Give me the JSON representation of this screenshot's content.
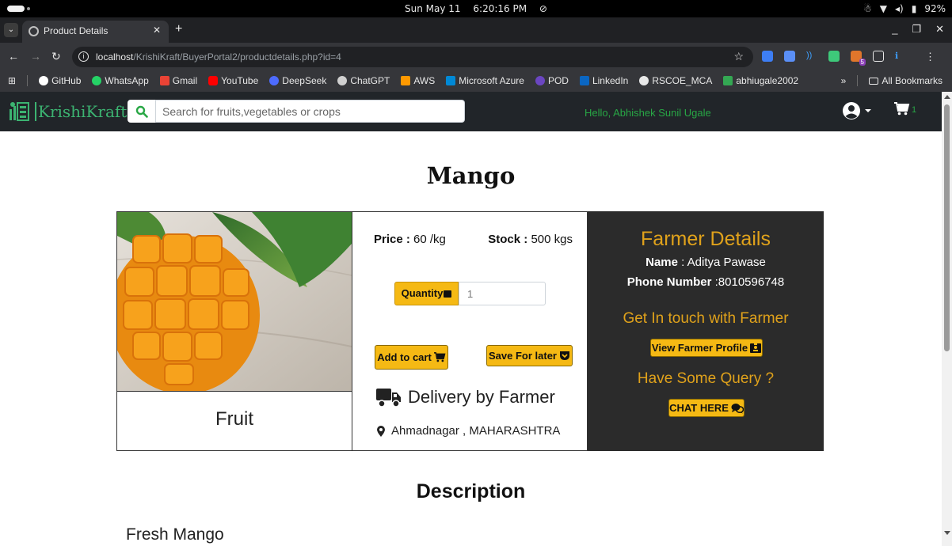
{
  "os": {
    "clock_date": "Sun May 11",
    "clock_time": "6:20:16 PM",
    "battery": "92%"
  },
  "browser": {
    "tab_title": "Product Details",
    "url_host": "localhost",
    "url_path": "/KrishiKraft/BuyerPortal2/productdetails.php?id=4",
    "extension_badge": "5",
    "bookmarks": [
      "GitHub",
      "WhatsApp",
      "Gmail",
      "YouTube",
      "DeepSeek",
      "ChatGPT",
      "AWS",
      "Microsoft Azure",
      "POD",
      "LinkedIn",
      "RSCOE_MCA",
      "abhiugale2002"
    ],
    "bookmarks_overflow": "»",
    "all_bookmarks": "All Bookmarks"
  },
  "site": {
    "logo_text": "KrishiKraft",
    "search_placeholder": "Search for fruits,vegetables or crops",
    "greeting": "Hello, Abhishek Sunil Ugale",
    "cart_count": "1"
  },
  "product": {
    "name": "Mango",
    "category": "Fruit",
    "price_label": "Price :",
    "price_value": "60 /kg",
    "stock_label": "Stock :",
    "stock_value": "500 kgs",
    "quantity_label": "Quantity",
    "quantity_value": "1",
    "add_to_cart": "Add to cart",
    "save_for_later": "Save For later",
    "delivery": "Delivery by Farmer",
    "location": "Ahmadnagar , MAHARASHTRA"
  },
  "farmer": {
    "heading": "Farmer Details",
    "name_label": "Name",
    "name_value": ": Aditya Pawase",
    "phone_label": "Phone Number",
    "phone_value": ":8010596748",
    "contact_heading": "Get In touch with Farmer",
    "view_profile": "View Farmer Profile",
    "query_heading": "Have Some Query ?",
    "chat_here": "CHAT HERE"
  },
  "description": {
    "heading": "Description",
    "text": "Fresh Mango"
  },
  "colors": {
    "accent_yellow": "#f5b914",
    "farmer_panel": "#2b2b2b",
    "brand_green": "#3cb371",
    "navbar": "#212529"
  }
}
